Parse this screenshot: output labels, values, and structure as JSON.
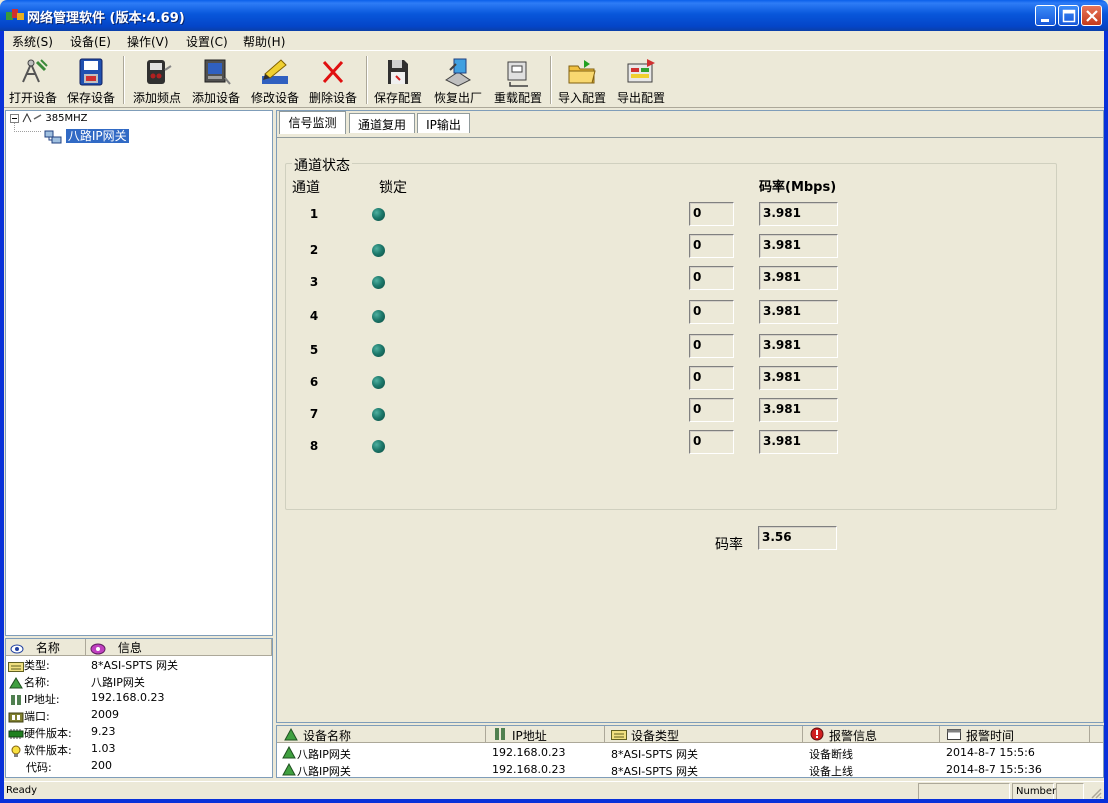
{
  "window": {
    "title": "网络管理软件 (版本:4.69)"
  },
  "menu": [
    {
      "label": "系统(S)"
    },
    {
      "label": "设备(E)"
    },
    {
      "label": "操作(V)"
    },
    {
      "label": "设置(C)"
    },
    {
      "label": "帮助(H)"
    }
  ],
  "toolbar": [
    {
      "label": "打开设备",
      "icon": "open-device-icon"
    },
    {
      "label": "保存设备",
      "icon": "save-device-icon"
    },
    {
      "label": "添加频点",
      "icon": "add-frequency-icon"
    },
    {
      "label": "添加设备",
      "icon": "add-device-icon"
    },
    {
      "label": "修改设备",
      "icon": "edit-device-icon"
    },
    {
      "label": "删除设备",
      "icon": "delete-device-icon"
    },
    {
      "label": "保存配置",
      "icon": "save-config-icon"
    },
    {
      "label": "恢复出厂",
      "icon": "factory-reset-icon"
    },
    {
      "label": "重载配置",
      "icon": "reload-config-icon"
    },
    {
      "label": "导入配置",
      "icon": "import-config-icon"
    },
    {
      "label": "导出配置",
      "icon": "export-config-icon"
    }
  ],
  "tree": {
    "root": "385MHZ",
    "child": "八路IP网关"
  },
  "info": {
    "headers": {
      "name": "名称",
      "info": "信息"
    },
    "rows": [
      {
        "key": "类型:",
        "value": "8*ASI-SPTS 网关"
      },
      {
        "key": "名称:",
        "value": "八路IP网关"
      },
      {
        "key": "IP地址:",
        "value": "192.168.0.23"
      },
      {
        "key": "端口:",
        "value": "2009"
      },
      {
        "key": "硬件版本:",
        "value": "9.23"
      },
      {
        "key": "软件版本:",
        "value": "1.03"
      },
      {
        "key": "代码:",
        "value": "200"
      }
    ]
  },
  "tabs": [
    {
      "label": "信号监测",
      "active": true
    },
    {
      "label": "通道复用",
      "active": false
    },
    {
      "label": "IP输出",
      "active": false
    }
  ],
  "monitor": {
    "group_title": "通道状态",
    "col_channel": "通道",
    "col_lock": "锁定",
    "col_rate": "码率(Mbps)",
    "channels": [
      {
        "num": "1",
        "field": "0",
        "rate": "3.981"
      },
      {
        "num": "2",
        "field": "0",
        "rate": "3.981"
      },
      {
        "num": "3",
        "field": "0",
        "rate": "3.981"
      },
      {
        "num": "4",
        "field": "0",
        "rate": "3.981"
      },
      {
        "num": "5",
        "field": "0",
        "rate": "3.981"
      },
      {
        "num": "6",
        "field": "0",
        "rate": "3.981"
      },
      {
        "num": "7",
        "field": "0",
        "rate": "3.981"
      },
      {
        "num": "8",
        "field": "0",
        "rate": "3.981"
      }
    ],
    "total_rate_label": "码率",
    "total_rate": "3.56"
  },
  "log": {
    "headers": {
      "name": "设备名称",
      "ip": "IP地址",
      "type": "设备类型",
      "alarm": "报警信息",
      "time": "报警时间"
    },
    "rows": [
      {
        "name": "八路IP网关",
        "ip": "192.168.0.23",
        "type": "8*ASI-SPTS 网关",
        "alarm": "设备断线",
        "time": "2014-8-7 15:5:6"
      },
      {
        "name": "八路IP网关",
        "ip": "192.168.0.23",
        "type": "8*ASI-SPTS 网关",
        "alarm": "设备上线",
        "time": "2014-8-7 15:5:36"
      }
    ]
  },
  "status": {
    "text": "Ready",
    "indicator": "Number"
  },
  "colors": {
    "titlebar": "#0A5FEA",
    "selection": "#316AC5",
    "led": "#1E7A6C",
    "face": "#ECE9D8"
  }
}
